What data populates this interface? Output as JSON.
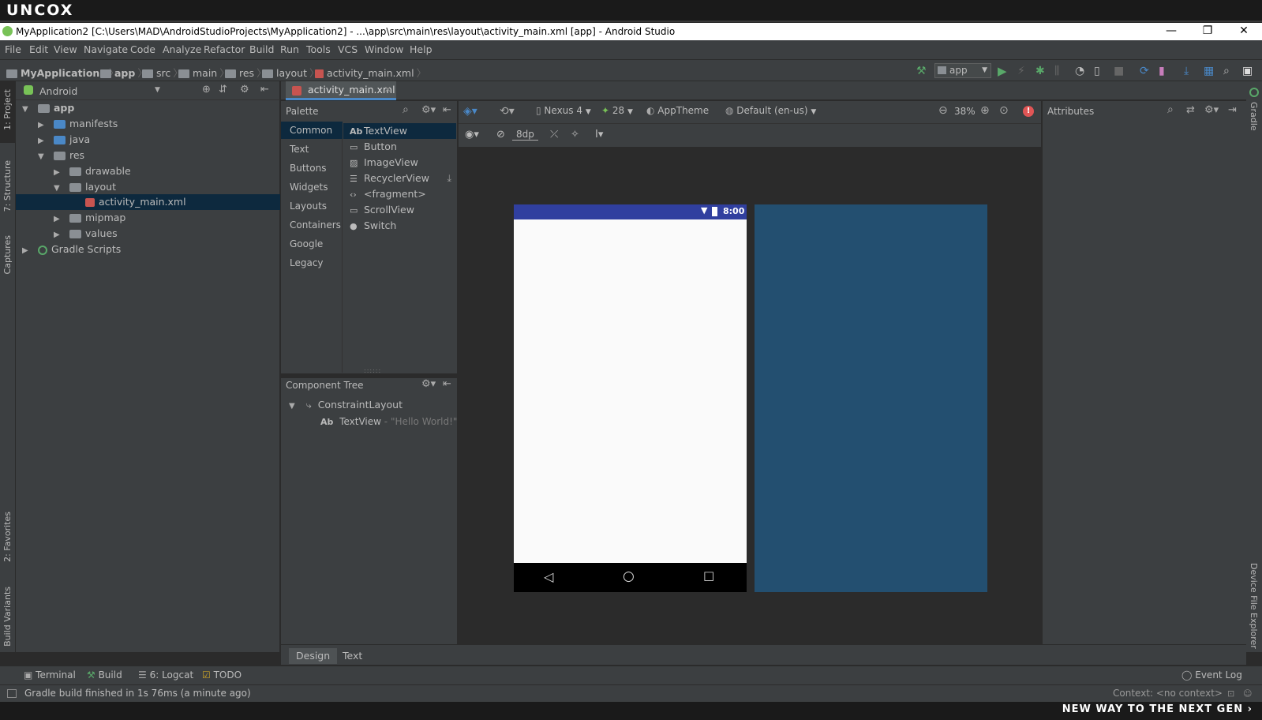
{
  "brand": "uncox",
  "window": {
    "title": "MyApplication2 [C:\\Users\\MAD\\AndroidStudioProjects\\MyApplication2] - ...\\app\\src\\main\\res\\layout\\activity_main.xml [app] - Android Studio",
    "minimize": "—",
    "restore": "❐",
    "close": "✕"
  },
  "menu": [
    "File",
    "Edit",
    "View",
    "Navigate",
    "Code",
    "Analyze",
    "Refactor",
    "Build",
    "Run",
    "Tools",
    "VCS",
    "Window",
    "Help"
  ],
  "breadcrumb": [
    "MyApplication2",
    "app",
    "src",
    "main",
    "res",
    "layout",
    "activity_main.xml"
  ],
  "toolbar": {
    "run_config": "app"
  },
  "left_strip": {
    "project": "1: Project",
    "structure": "7: Structure",
    "captures": "Captures",
    "favorites": "2: Favorites",
    "build_variants": "Build Variants"
  },
  "right_strip": {
    "gradle": "Gradle",
    "device_file_explorer": "Device File Explorer"
  },
  "project": {
    "view": "Android",
    "tree": [
      {
        "label": "app",
        "level": 0,
        "state": "open",
        "kind": "module"
      },
      {
        "label": "manifests",
        "level": 1,
        "state": "closed",
        "kind": "folder"
      },
      {
        "label": "java",
        "level": 1,
        "state": "closed",
        "kind": "folder"
      },
      {
        "label": "res",
        "level": 1,
        "state": "open",
        "kind": "folder"
      },
      {
        "label": "drawable",
        "level": 2,
        "state": "closed",
        "kind": "folder"
      },
      {
        "label": "layout",
        "level": 2,
        "state": "open",
        "kind": "folder"
      },
      {
        "label": "activity_main.xml",
        "level": 3,
        "state": "leaf",
        "kind": "xml",
        "selected": true
      },
      {
        "label": "mipmap",
        "level": 2,
        "state": "closed",
        "kind": "folder"
      },
      {
        "label": "values",
        "level": 2,
        "state": "closed",
        "kind": "folder"
      },
      {
        "label": "Gradle Scripts",
        "level": 0,
        "state": "closed",
        "kind": "gradle"
      }
    ]
  },
  "editor": {
    "tab": "activity_main.xml"
  },
  "palette": {
    "title": "Palette",
    "categories": [
      "Common",
      "Text",
      "Buttons",
      "Widgets",
      "Layouts",
      "Containers",
      "Google",
      "Legacy"
    ],
    "selected_category": "Common",
    "widgets": [
      {
        "icon": "Ab",
        "label": "TextView"
      },
      {
        "icon": "▭",
        "label": "Button"
      },
      {
        "icon": "▨",
        "label": "ImageView"
      },
      {
        "icon": "☰",
        "label": "RecyclerView"
      },
      {
        "icon": "‹›",
        "label": "<fragment>"
      },
      {
        "icon": "▭",
        "label": "ScrollView"
      },
      {
        "icon": "●",
        "label": "Switch"
      }
    ]
  },
  "component_tree": {
    "title": "Component Tree",
    "root": "ConstraintLayout",
    "child_type": "TextView",
    "child_text": "- \"Hello World!\""
  },
  "canvas_toolbar": {
    "device": "Nexus 4",
    "api": "28",
    "theme": "AppTheme",
    "locale": "Default (en-us)",
    "zoom": "38%",
    "margin": "8dp"
  },
  "phone": {
    "time": "8:00"
  },
  "attributes": {
    "title": "Attributes"
  },
  "design_tabs": [
    "Design",
    "Text"
  ],
  "bottom_tools": {
    "terminal": "Terminal",
    "build": "Build",
    "logcat": "6: Logcat",
    "todo": "TODO",
    "event_log": "Event Log"
  },
  "status": {
    "message": "Gradle build finished in 1s 76ms (a minute ago)",
    "context": "Context: <no context>"
  },
  "slogan": "NEW WAY TO THE NEXT GEN ›",
  "colors": {
    "accent": "#4a88c7",
    "status_bar": "#303f9f",
    "blueprint": "#234f70",
    "run": "#59a869",
    "error": "#e05555"
  }
}
